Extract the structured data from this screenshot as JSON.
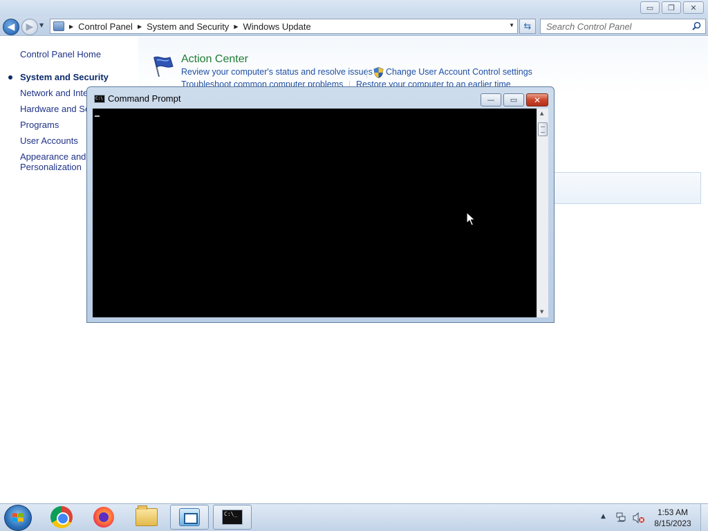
{
  "window": {
    "caption_buttons": {
      "minimize": "▭",
      "maximize": "❐",
      "close": "✕"
    }
  },
  "nav": {
    "breadcrumb": [
      "Control Panel",
      "System and Security",
      "Windows Update"
    ],
    "search_placeholder": "Search Control Panel"
  },
  "sidebar": {
    "items": [
      {
        "label": "Control Panel Home"
      },
      {
        "label": "System and Security",
        "selected": true
      },
      {
        "label": "Network and Inter"
      },
      {
        "label": "Hardware and Sou"
      },
      {
        "label": "Programs"
      },
      {
        "label": "User Accounts"
      },
      {
        "label": "Appearance and",
        "label2": "Personalization"
      }
    ]
  },
  "main": {
    "action_center": {
      "title": "Action Center",
      "links": [
        "Review your computer's status and resolve issues",
        "Change User Account Control settings",
        "Troubleshoot common computer problems",
        "Restore your computer to an earlier time"
      ]
    }
  },
  "cmd": {
    "title": "Command Prompt",
    "icon_text": "C:\\",
    "close_glyph": "✕",
    "min_glyph": "—",
    "max_glyph": "▭"
  },
  "taskbar": {
    "apps": [
      "Google Chrome",
      "Firefox",
      "Windows Explorer",
      "Control Panel",
      "Command Prompt"
    ],
    "cmd_icon_text": "C:\\_",
    "clock_time": "1:53 AM",
    "clock_date": "8/15/2023"
  },
  "colors": {
    "link": "#1e4fa3",
    "heading_green": "#1e7b34",
    "sidebar_link": "#1e3287",
    "taskbar_top": "#dfe9f5"
  }
}
